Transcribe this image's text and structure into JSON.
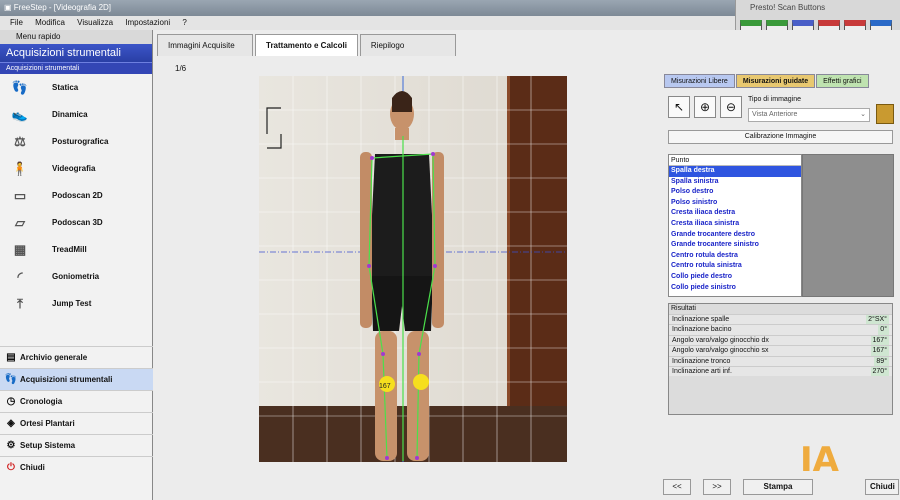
{
  "window": {
    "title": "FreeStep - [Videografia 2D]"
  },
  "menu": [
    "File",
    "Modifica",
    "Visualizza",
    "Impostazioni",
    "?"
  ],
  "presto": {
    "title": "Presto! Scan Buttons",
    "buttons": [
      {
        "label": "Color",
        "icon": "color-scan-icon",
        "color": "#3a9a3a"
      },
      {
        "label": "B/W",
        "icon": "bw-scan-icon",
        "color": "#3a9a3a"
      },
      {
        "label": "JPG",
        "icon": "jpg-icon",
        "color": "#4a5fc8"
      },
      {
        "label": "TIFF",
        "icon": "tiff-icon",
        "color": "#c83a3a"
      },
      {
        "label": "PDF",
        "icon": "pdf-icon",
        "color": "#c83a3a"
      },
      {
        "label": "OCR",
        "icon": "ocr-icon",
        "color": "#2a6ac8"
      }
    ]
  },
  "sidebar": {
    "header": "Menu rapido",
    "title": "Acquisizioni strumentali",
    "subtitle": "Acquisizioni strumentali",
    "tools": [
      {
        "label": "Statica",
        "icon": "feet-icon"
      },
      {
        "label": "Dinamica",
        "icon": "footprints-icon"
      },
      {
        "label": "Posturografica",
        "icon": "posture-icon"
      },
      {
        "label": "Videografia",
        "icon": "video-figure-icon"
      },
      {
        "label": "Podoscan 2D",
        "icon": "scanner-icon"
      },
      {
        "label": "Podoscan 3D",
        "icon": "scanner-3d-icon"
      },
      {
        "label": "TreadMill",
        "icon": "treadmill-icon"
      },
      {
        "label": "Goniometria",
        "icon": "goniometer-icon"
      },
      {
        "label": "Jump Test",
        "icon": "jump-icon"
      }
    ],
    "nav": [
      {
        "label": "Archivio generale",
        "icon": "archive-icon"
      },
      {
        "label": "Acquisizioni strumentali",
        "icon": "acquisition-icon",
        "selected": true
      },
      {
        "label": "Cronologia",
        "icon": "history-icon"
      },
      {
        "label": "Ortesi Plantari",
        "icon": "orthotic-icon"
      },
      {
        "label": "Setup Sistema",
        "icon": "setup-icon"
      },
      {
        "label": "Chiudi",
        "icon": "power-icon"
      }
    ]
  },
  "main": {
    "tabs": [
      "Immagini Acquisite",
      "Trattamento e Calcoli",
      "Riepilogo"
    ],
    "active_tab": 1,
    "page_counter": "1/6",
    "image_label": "167"
  },
  "right": {
    "tabs": [
      "Misurazioni Libere",
      "Misurazioni guidate",
      "Effetti grafici"
    ],
    "image_type_label": "Tipo di immagine",
    "image_type_value": "Vista Anteriore",
    "calibration_button": "Calibrazione Immagine",
    "points_header": "Punto",
    "points": [
      "Spalla destra",
      "Spalla sinistra",
      "Polso destro",
      "Polso sinistro",
      "Cresta iliaca destra",
      "Cresta iliaca sinistra",
      "Grande trocantere destro",
      "Grande trocantere sinistro",
      "Centro rotula destra",
      "Centro rotula sinistra",
      "Collo piede destro",
      "Collo piede sinistro"
    ],
    "results_header": "Risultati",
    "results": [
      {
        "label": "Inclinazione spalle",
        "value": "2°SX°"
      },
      {
        "label": "Inclinazione bacino",
        "value": "0°"
      },
      {
        "label": "Angolo varo/valgo ginocchio dx",
        "value": "167°"
      },
      {
        "label": "Angolo varo/valgo ginocchio sx",
        "value": "167°"
      },
      {
        "label": "Inclinazione tronco",
        "value": "89°"
      },
      {
        "label": "Inclinazione arti inf.",
        "value": "270°"
      }
    ]
  },
  "bottom": {
    "prev": "<<",
    "next": ">>",
    "print": "Stampa",
    "close": "Chiudi"
  }
}
